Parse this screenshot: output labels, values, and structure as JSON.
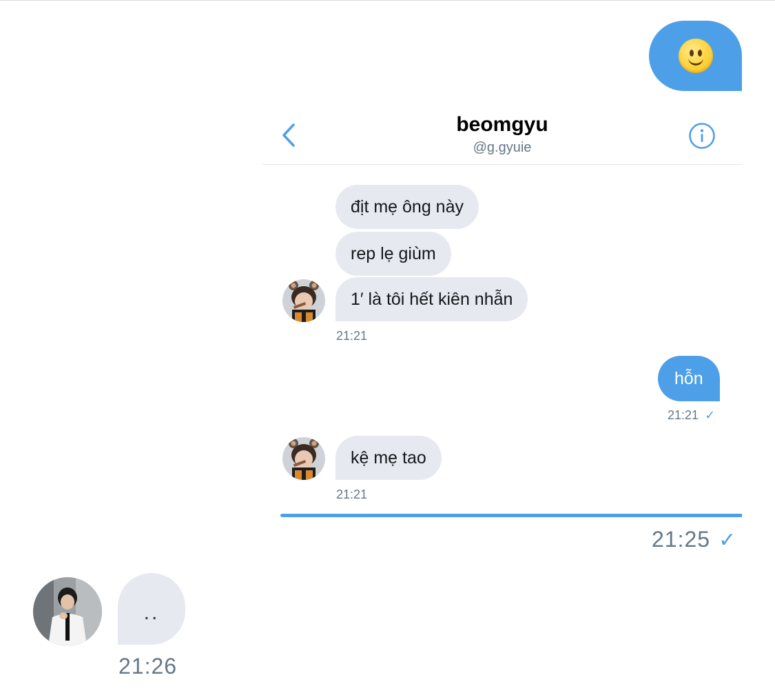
{
  "outer_chat": {
    "sent_emoji": "🙂",
    "sent_time": "21:25",
    "received_typing": "..",
    "received_time": "21:26"
  },
  "screenshot": {
    "header": {
      "name": "beomgyu",
      "handle": "@g.gyuie"
    },
    "messages": [
      {
        "direction": "in",
        "text": "địt mẹ ông này"
      },
      {
        "direction": "in",
        "text": "rep lẹ giùm"
      },
      {
        "direction": "in",
        "text": "1′ là tôi hết kiên nhẫn"
      },
      {
        "direction": "in_time",
        "text": "21:21"
      },
      {
        "direction": "out",
        "text": "hỗn"
      },
      {
        "direction": "out_time",
        "text": "21:21"
      },
      {
        "direction": "in",
        "text": "kệ mẹ tao"
      },
      {
        "direction": "in_time",
        "text": "21:21"
      }
    ]
  },
  "colors": {
    "accent": "#4d9fe8",
    "incoming_bubble": "#e6e9ef",
    "secondary_text": "#657786"
  },
  "icons": {
    "back": "chevron-left-icon",
    "info": "info-circle-icon",
    "read_check": "checkmark-icon"
  }
}
